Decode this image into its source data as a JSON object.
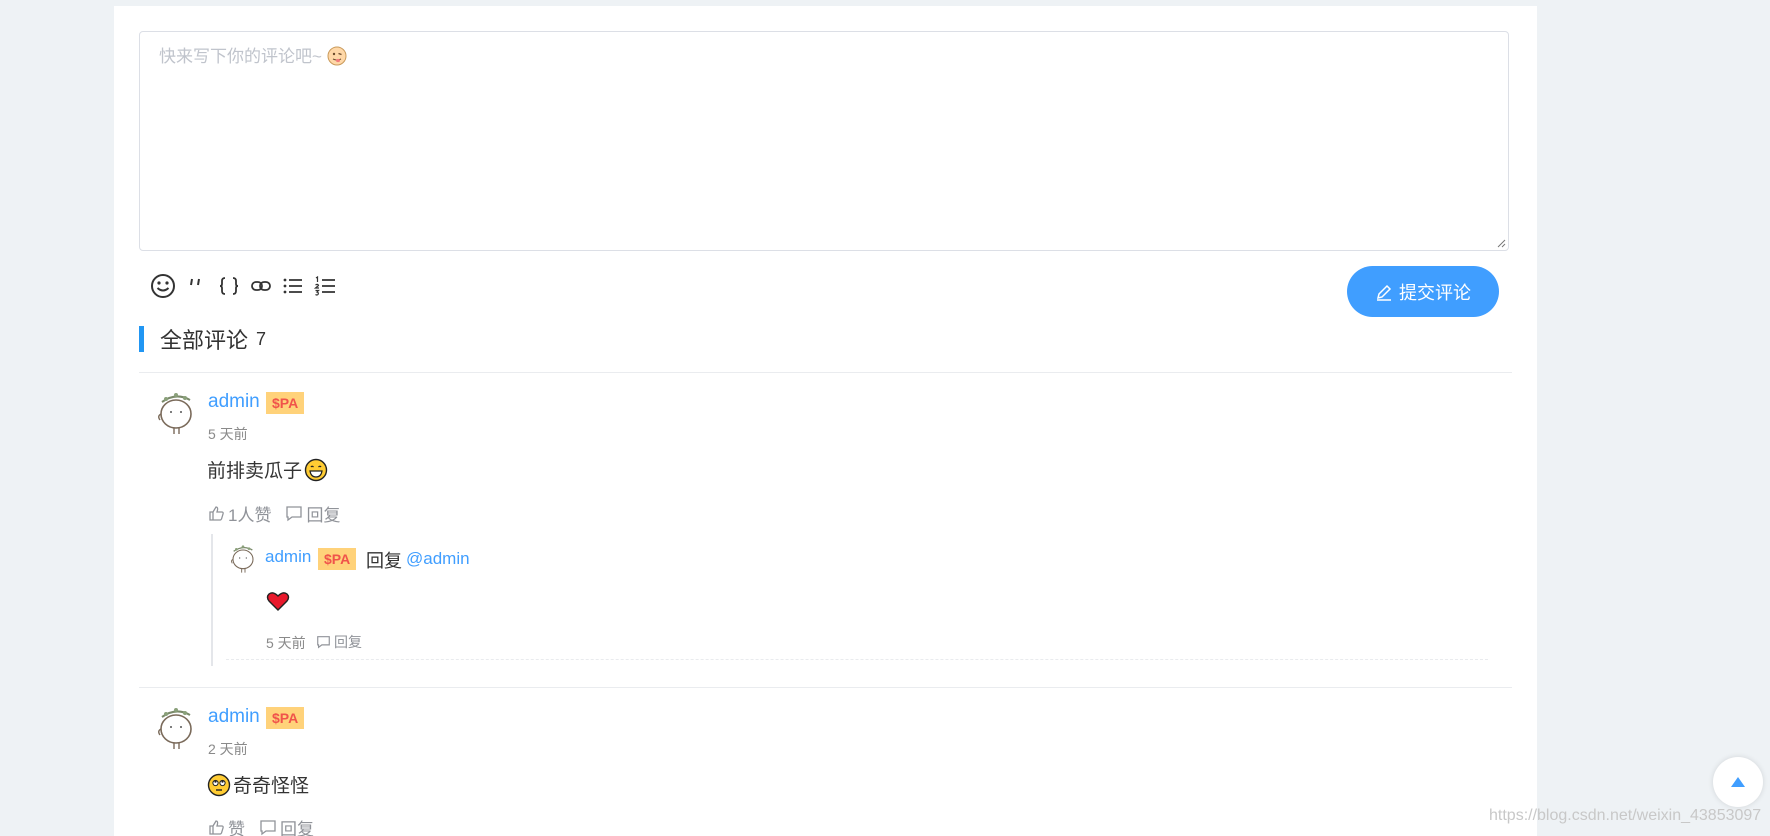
{
  "editor": {
    "placeholder": "快来写下你的评论吧~",
    "tools": [
      "emoji-icon",
      "quote-icon",
      "code-icon",
      "link-icon",
      "unordered-list-icon",
      "ordered-list-icon"
    ],
    "submit_label": "提交评论"
  },
  "comments_section": {
    "title": "全部评论",
    "count": "7"
  },
  "comments": [
    {
      "user": "admin",
      "badge": "$PA",
      "time": "5 天前",
      "text": "前排卖瓜子",
      "emoji": "grinning-emoji",
      "like_label": "1人赞",
      "reply_label": "回复",
      "replies": [
        {
          "user": "admin",
          "badge": "$PA",
          "reply_word": "回复",
          "mention": "@admin",
          "emoji": "heart-emoji",
          "time": "5 天前",
          "reply_label": "回复"
        }
      ]
    },
    {
      "user": "admin",
      "badge": "$PA",
      "time": "2 天前",
      "text": "奇奇怪怪",
      "emoji": "rolling-eyes-emoji",
      "like_label": "赞",
      "reply_label": "回复"
    }
  ],
  "watermark": "https://blog.csdn.net/weixin_43853097",
  "colors": {
    "accent": "#409eff",
    "badge_bg": "#ffd27a",
    "badge_text": "#f0534b",
    "title_bar": "#2196f3"
  }
}
